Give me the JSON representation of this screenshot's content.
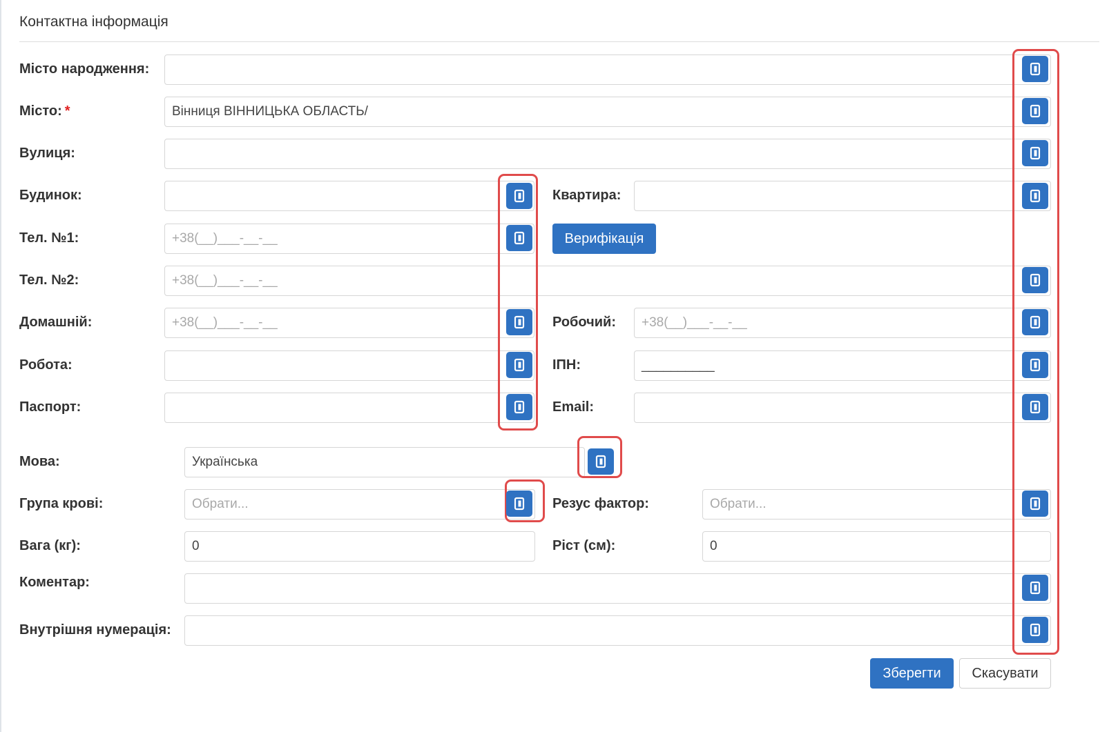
{
  "section": {
    "title": "Контактна інформація"
  },
  "fields": {
    "birth_city": {
      "label": "Місто народження:",
      "value": ""
    },
    "city": {
      "label": "Місто:",
      "required_mark": "*",
      "value": "Вінниця  ВІННИЦЬКА ОБЛАСТЬ/"
    },
    "street": {
      "label": "Вулиця:",
      "value": ""
    },
    "house": {
      "label": "Будинок:",
      "value": ""
    },
    "apartment": {
      "label": "Квартира:",
      "value": ""
    },
    "phone1": {
      "label": "Тел. №1:",
      "value": "+38(__)___-__-__"
    },
    "phone2": {
      "label": "Тел. №2:",
      "value": "+38(__)___-__-__"
    },
    "home_phone": {
      "label": "Домашній:",
      "value": "+38(__)___-__-__"
    },
    "work_phone": {
      "label": "Робочий:",
      "value": "+38(__)___-__-__"
    },
    "work": {
      "label": "Робота:",
      "value": ""
    },
    "tax_id": {
      "label": "ІПН:",
      "value": "__________"
    },
    "passport": {
      "label": "Паспорт:",
      "value": ""
    },
    "email": {
      "label": "Email:",
      "value": ""
    },
    "language": {
      "label": "Мова:",
      "value": "Українська"
    },
    "blood_group": {
      "label": "Група крові:",
      "placeholder": "Обрати..."
    },
    "rh_factor": {
      "label": "Резус фактор:",
      "placeholder": "Обрати..."
    },
    "weight": {
      "label": "Вага (кг):",
      "value": "0"
    },
    "height": {
      "label": "Ріст (см):",
      "value": "0"
    },
    "comment": {
      "label": "Коментар:",
      "value": ""
    },
    "internal_number": {
      "label": "Внутрішня нумерація:",
      "value": ""
    }
  },
  "buttons": {
    "verify": "Верифікація",
    "save": "Зберегти",
    "cancel": "Скасувати"
  },
  "icons": {
    "copy": "copy-icon"
  },
  "colors": {
    "primary": "#2f72c2",
    "highlight": "#e04b4b",
    "required": "#e02020"
  }
}
